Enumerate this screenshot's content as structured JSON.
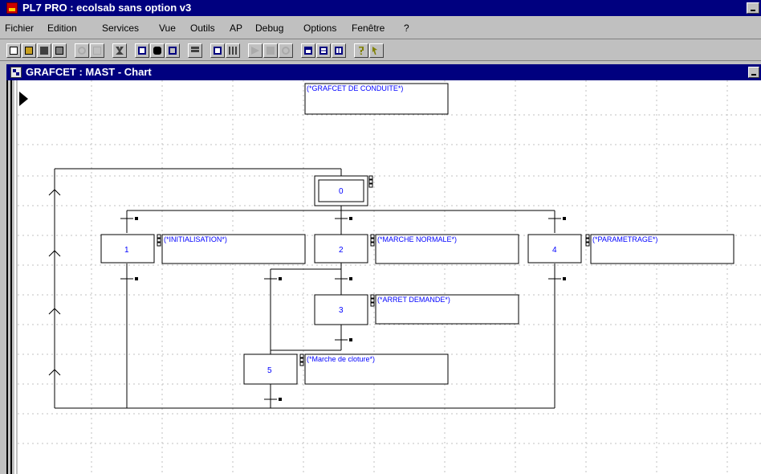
{
  "app": {
    "title": "PL7 PRO : ecolsab sans option v3"
  },
  "menu": [
    {
      "id": "fichier",
      "label": "Fichier"
    },
    {
      "id": "edition",
      "label": "Edition"
    },
    {
      "id": "services",
      "label": "Services"
    },
    {
      "id": "vue",
      "label": "Vue"
    },
    {
      "id": "outils",
      "label": "Outils"
    },
    {
      "id": "ap",
      "label": "AP"
    },
    {
      "id": "debug",
      "label": "Debug"
    },
    {
      "id": "options",
      "label": "Options"
    },
    {
      "id": "fenetre",
      "label": "Fenêtre"
    },
    {
      "id": "help",
      "label": "?"
    }
  ],
  "toolbar": [
    {
      "icon": "new-icon",
      "enabled": true,
      "color": "#ffffff"
    },
    {
      "icon": "open-icon",
      "enabled": true,
      "color": "#c8a020"
    },
    {
      "icon": "save-icon",
      "enabled": true,
      "color": "#404040"
    },
    {
      "icon": "print-icon",
      "enabled": true,
      "color": "#404040"
    },
    {
      "icon": "undo-icon",
      "enabled": false,
      "color": "#808080"
    },
    {
      "icon": "validate-icon",
      "enabled": false,
      "color": "#808080"
    },
    {
      "icon": "cut-icon",
      "enabled": true,
      "color": "#404040"
    },
    {
      "icon": "calculator-icon",
      "enabled": true,
      "color": "#00007f"
    },
    {
      "icon": "find-icon",
      "enabled": true,
      "color": "#000000"
    },
    {
      "icon": "replace-icon",
      "enabled": true,
      "color": "#00007f"
    },
    {
      "icon": "variables-icon",
      "enabled": true,
      "color": "#404040"
    },
    {
      "icon": "connect-icon",
      "enabled": true,
      "color": "#00007f"
    },
    {
      "icon": "plc-icon",
      "enabled": true,
      "color": "#404040"
    },
    {
      "icon": "run-icon",
      "enabled": false,
      "color": "#808080"
    },
    {
      "icon": "stop-icon",
      "enabled": false,
      "color": "#808080"
    },
    {
      "icon": "init-icon",
      "enabled": false,
      "color": "#808080"
    },
    {
      "icon": "cascade-icon",
      "enabled": true,
      "color": "#00007f"
    },
    {
      "icon": "tile-horizontal-icon",
      "enabled": true,
      "color": "#00007f"
    },
    {
      "icon": "tile-vertical-icon",
      "enabled": true,
      "color": "#00007f"
    },
    {
      "icon": "help-icon",
      "enabled": true,
      "color": "#808000"
    },
    {
      "icon": "context-help-icon",
      "enabled": true,
      "color": "#808000"
    }
  ],
  "chart_window": {
    "title": "GRAFCET : MAST - Chart"
  },
  "grafcet": {
    "header_comment": "(*GRAFCET DE CONDUITE*)",
    "initial_step": {
      "number": "0",
      "comment": ""
    },
    "steps": [
      {
        "number": "1",
        "comment": "(*INITIALISATION*)"
      },
      {
        "number": "2",
        "comment": "(*MARCHE NORMALE*)"
      },
      {
        "number": "4",
        "comment": "(*PARAMETRAGE*)"
      },
      {
        "number": "3",
        "comment": "(*ARRET DEMANDE*)"
      },
      {
        "number": "5",
        "comment": "(*Marche de cloture*)"
      }
    ]
  },
  "colors": {
    "title_bar": "#00007f",
    "grafcet_text": "#0000ff",
    "face": "#c0c0c0"
  }
}
